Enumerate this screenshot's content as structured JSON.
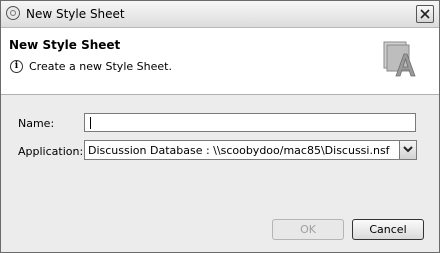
{
  "window": {
    "title": "New Style Sheet"
  },
  "header": {
    "title": "New Style Sheet",
    "description": "Create a new Style Sheet.",
    "info_glyph": "i"
  },
  "form": {
    "name_label": "Name:",
    "name_value": "",
    "application_label": "Application:",
    "application_value": "Discussion Database : \\\\scoobydoo/mac85\\Discussi.nsf"
  },
  "buttons": {
    "ok_label": "OK",
    "cancel_label": "Cancel"
  },
  "icons": {
    "app": "notes-app-icon",
    "close": "close-icon",
    "info": "info-icon",
    "wizard": "style-sheet-wizard-icon",
    "dropdown": "chevron-down-icon"
  }
}
